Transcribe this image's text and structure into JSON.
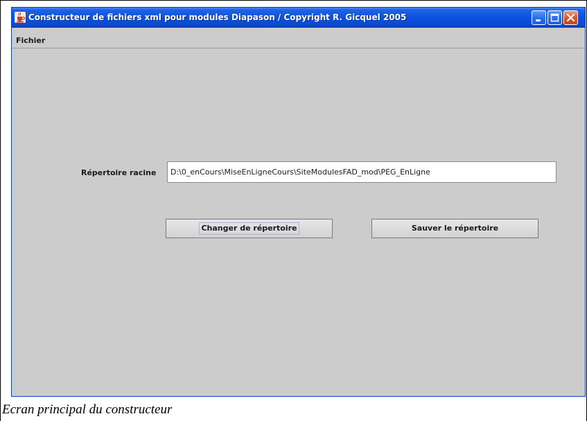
{
  "window": {
    "title": "Constructeur de fichiers xml pour modules Diapason / Copyright R. Gicquel 2005",
    "controls": {
      "minimize_icon": "minimize-icon",
      "maximize_icon": "maximize-icon",
      "close_icon": "close-icon"
    },
    "app_icon": "java-cup-icon"
  },
  "menubar": {
    "items": [
      {
        "label": "Fichier"
      }
    ]
  },
  "form": {
    "root_dir_label": "Répertoire racine",
    "root_dir_value": "D:\\0_enCours\\MiseEnLigneCours\\SiteModulesFAD_mod\\PEG_EnLigne"
  },
  "buttons": {
    "change_dir": "Changer de répertoire",
    "save_dir": "Sauver le répertoire"
  },
  "caption": "Ecran principal du constructeur",
  "colors": {
    "titlebar": "#0b52df",
    "window_bg": "#cccccc",
    "close_button": "#e2572c"
  }
}
